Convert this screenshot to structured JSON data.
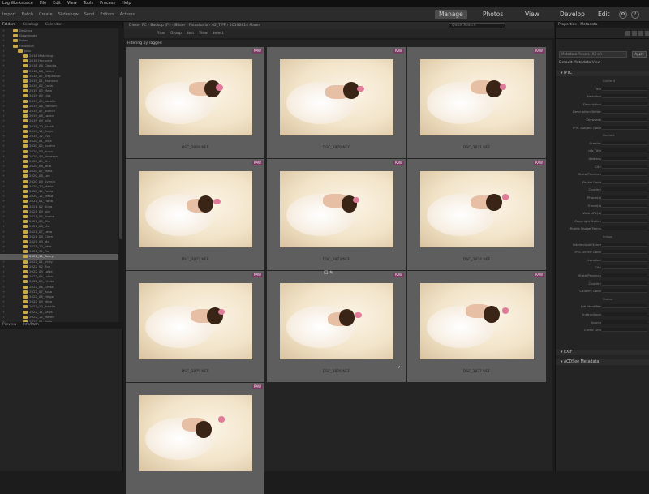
{
  "menu": [
    "Log Workspace",
    "File",
    "Edit",
    "View",
    "Tools",
    "Process",
    "Help"
  ],
  "toolbar": {
    "items": [
      "Import",
      "Batch",
      "Create",
      "Slideshow",
      "Send",
      "Editors",
      "Actions"
    ],
    "modes": [
      "Manage",
      "Photos",
      "View",
      "Develop",
      "Edit"
    ],
    "active_mode": "Manage"
  },
  "left_panel": {
    "tabs": [
      "Folders",
      "Catalogs",
      "Calendar"
    ],
    "bottom_tabs": [
      "Preview",
      "Info/Path"
    ],
    "tree": [
      "Desktop",
      "Downloads",
      "Fotos",
      "Fotobuch",
      "Jobs",
      "2016 Matching",
      "2018 Hochzeit",
      "2018_06_Claudia",
      "2018_06_Helen",
      "2018_07_Stephanie",
      "2019_01_Ramona",
      "2019_02_Carla",
      "2019_03_Maja",
      "2019_04_Lisa",
      "2019_05_Natalie",
      "2019_06_Hannah",
      "2019_07_Bianca",
      "2019_08_Laura",
      "2019_09_Julia",
      "2019_10_Sarah",
      "2019_11_Tanja",
      "2019_12_Eva",
      "2020_01_Nina",
      "2020_02_Sophie",
      "2020_03_Anna",
      "2020_04_Vanessa",
      "2020_05_Kim",
      "2020_06_Jana",
      "2020_07_Mara",
      "2020_08_Lea",
      "2020_09_Svenja",
      "2020_10_Marie",
      "2020_11_Paula",
      "2020_12_Tessa",
      "2021_01_Fiona",
      "2021_02_Alina",
      "2021_03_Jule",
      "2021_04_Emma",
      "2021_05_Ella",
      "2021_06_Mia",
      "2021_07_Lena",
      "2021_08_Clara",
      "2021_09_Ida",
      "2021_10_Nele",
      "2021_11_Pia",
      "2021_12_Romy",
      "2022_01_Vicky",
      "2022_02_Zoe",
      "2022_03_Lotte",
      "2022_04_Luisa",
      "2022_05_Frieda",
      "2022_06_Greta",
      "2022_07_Rosa",
      "2022_08_Helga",
      "2022_09_Mina",
      "2022_10_Amelie",
      "2022_11_Katja",
      "2022_12_Maren",
      "2023_01_Selin"
    ],
    "selected_index": 45
  },
  "center": {
    "path": [
      "Dieser PC",
      "Backup (F:)",
      "Bilder",
      "Fotostudio",
      "02_TIFF",
      "20190614 Maren"
    ],
    "search_placeholder": "Quick Search",
    "filter_items": [
      "Filter",
      "Group",
      "Sort",
      "View",
      "Select"
    ],
    "filter_label": "Filtering by Tagged",
    "raw_badge": "RAW",
    "thumbnails": [
      {
        "name": "DSC_3869.NEF",
        "raw": true
      },
      {
        "name": "DSC_3870.NEF",
        "raw": true
      },
      {
        "name": "DSC_3871.NEF",
        "raw": true
      },
      {
        "name": "DSC_3872.NEF",
        "raw": true
      },
      {
        "name": "DSC_3873.NEF",
        "raw": true
      },
      {
        "name": "DSC_3874.NEF",
        "raw": true
      },
      {
        "name": "DSC_3875.NEF",
        "raw": true
      },
      {
        "name": "DSC_3876.NEF",
        "raw": true
      },
      {
        "name": "DSC_3877.NEF",
        "raw": true
      },
      {
        "name": "",
        "raw": true
      }
    ]
  },
  "right_panel": {
    "title": "Properties - Metadata",
    "preset": "Metadata Presets (XX of)",
    "apply": "Apply",
    "subtitle": "Default Metadata View",
    "sections": [
      "IPTC",
      "EXIF",
      "ACDSee Metadata"
    ],
    "fields": [
      "Content",
      "Title",
      "Headline",
      "Description",
      "Description Writer",
      "Keywords",
      "IPTC Subject Code",
      "Contact",
      "Creator",
      "Job Title",
      "Address",
      "City",
      "State/Province",
      "Postal Code",
      "Country",
      "Phone(s)",
      "Email(s)",
      "Web URL(s)",
      "Copyright Notice",
      "Rights Usage Terms",
      "Image",
      "Intellectual Genre",
      "IPTC Scene Code",
      "Location",
      "City",
      "State/Province",
      "Country",
      "Country Code",
      "Status",
      "Job Identifier",
      "Instructions",
      "Source",
      "Credit Line"
    ],
    "group_headers": [
      "Content",
      "Contact",
      "Copyright",
      "Image",
      "Status"
    ]
  }
}
